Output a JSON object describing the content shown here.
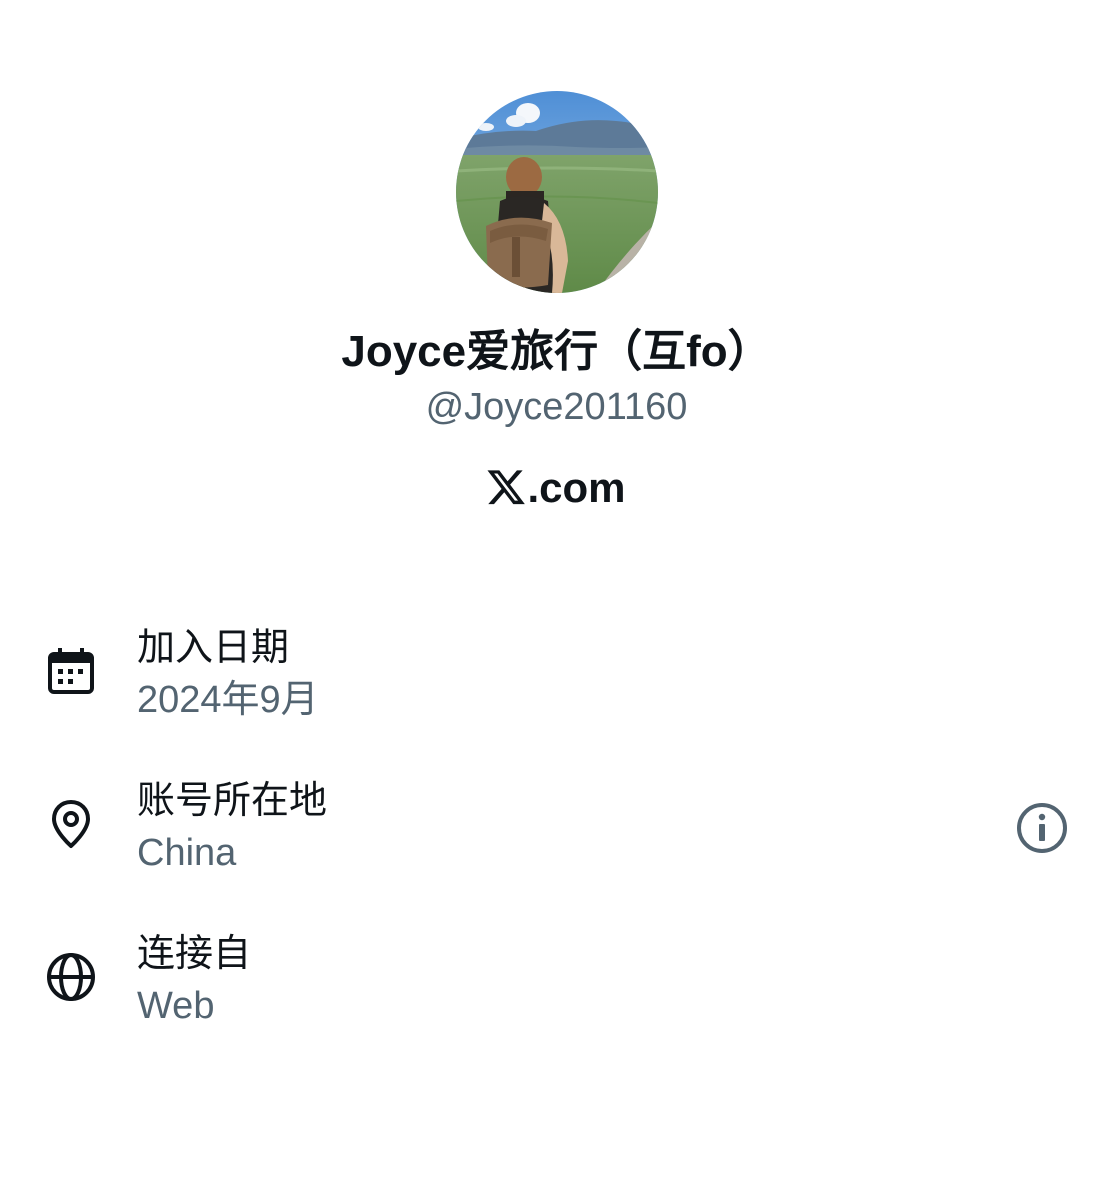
{
  "profile": {
    "display_name": "Joyce爱旅行（互fo）",
    "handle": "@Joyce201160",
    "brand_suffix": ".com"
  },
  "details": [
    {
      "label": "加入日期",
      "value": "2024年9月",
      "icon": "calendar-icon"
    },
    {
      "label": "账号所在地",
      "value": "China",
      "icon": "location-pin-icon"
    },
    {
      "label": "连接自",
      "value": "Web",
      "icon": "globe-icon"
    }
  ],
  "colors": {
    "primary_text": "#0f1419",
    "secondary_text": "#536471",
    "background": "#ffffff"
  }
}
